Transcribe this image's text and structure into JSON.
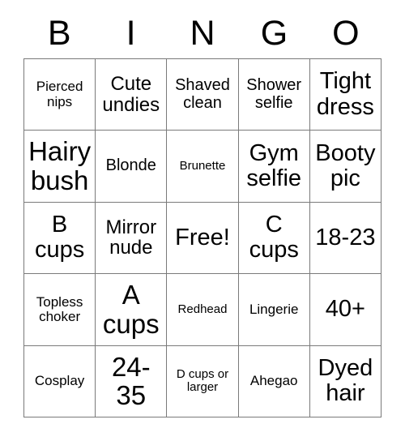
{
  "header": {
    "letters": [
      "B",
      "I",
      "N",
      "G",
      "O"
    ]
  },
  "grid": {
    "rows": 5,
    "columns": 5,
    "border_color": "#7a7a7a",
    "background_color": "#ffffff",
    "text_color": "#000000",
    "cells": [
      {
        "text": "Pierced nips",
        "size": "sm"
      },
      {
        "text": "Cute undies",
        "size": "lg"
      },
      {
        "text": "Shaved clean",
        "size": "md"
      },
      {
        "text": "Shower selfie",
        "size": "md"
      },
      {
        "text": "Tight dress",
        "size": "xl"
      },
      {
        "text": "Hairy bush",
        "size": "xxl"
      },
      {
        "text": "Blonde",
        "size": "md"
      },
      {
        "text": "Brunette",
        "size": "xs"
      },
      {
        "text": "Gym selfie",
        "size": "xl"
      },
      {
        "text": "Booty pic",
        "size": "xl"
      },
      {
        "text": "B cups",
        "size": "xl"
      },
      {
        "text": "Mirror nude",
        "size": "lg"
      },
      {
        "text": "Free!",
        "size": "xl"
      },
      {
        "text": "C cups",
        "size": "xl"
      },
      {
        "text": "18-23",
        "size": "xl"
      },
      {
        "text": "Topless choker",
        "size": "sm"
      },
      {
        "text": "A cups",
        "size": "xxl"
      },
      {
        "text": "Redhead",
        "size": "xs"
      },
      {
        "text": "Lingerie",
        "size": "sm"
      },
      {
        "text": "40+",
        "size": "xl"
      },
      {
        "text": "Cosplay",
        "size": "sm"
      },
      {
        "text": "24-35",
        "size": "xxl"
      },
      {
        "text": "D cups or larger",
        "size": "xs"
      },
      {
        "text": "Ahegao",
        "size": "sm"
      },
      {
        "text": "Dyed hair",
        "size": "xl"
      }
    ]
  }
}
